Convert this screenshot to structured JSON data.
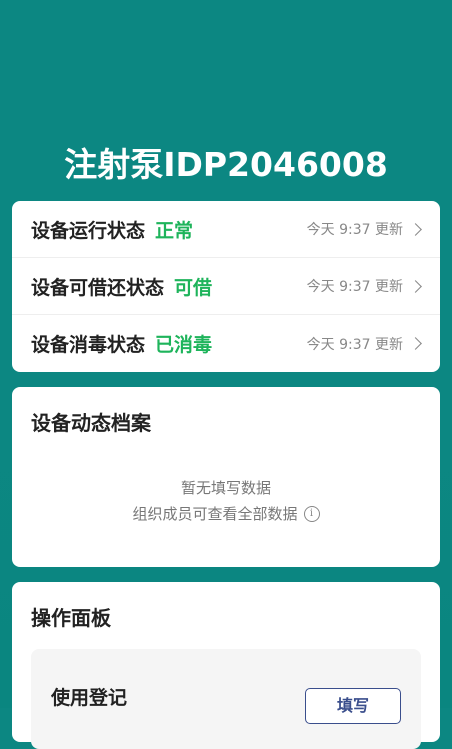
{
  "header": {
    "title": "注射泵IDP2046008"
  },
  "status_rows": [
    {
      "name": "设备运行状态",
      "value": "正常",
      "time": "今天 9:37 更新"
    },
    {
      "name": "设备可借还状态",
      "value": "可借",
      "time": "今天 9:37 更新"
    },
    {
      "name": "设备消毒状态",
      "value": "已消毒",
      "time": "今天 9:37 更新"
    }
  ],
  "archive": {
    "title": "设备动态档案",
    "empty_text": "暂无填写数据",
    "member_hint": "组织成员可查看全部数据"
  },
  "panel": {
    "title": "操作面板",
    "item_title": "使用登记",
    "fill_button": "填写"
  },
  "colors": {
    "brand": "#0c8782",
    "status_ok": "#1eb45b",
    "button": "#3a4e8c"
  }
}
